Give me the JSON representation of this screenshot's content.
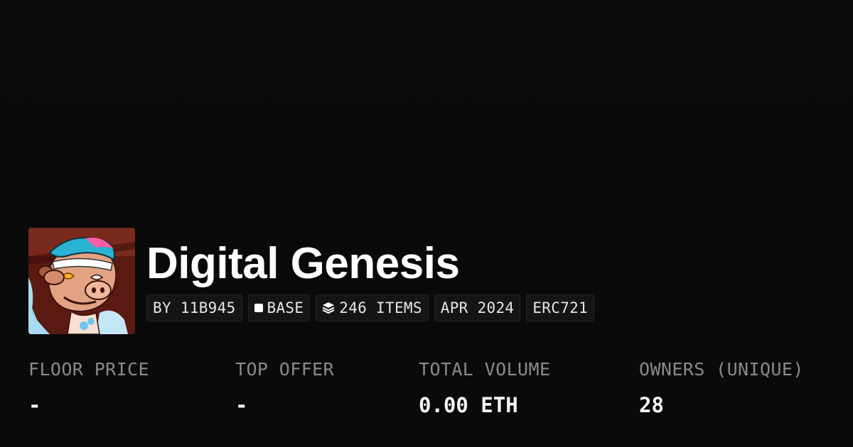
{
  "collection": {
    "name": "Digital Genesis"
  },
  "chips": [
    {
      "label": "BY 11B945",
      "icon": ""
    },
    {
      "label": "BASE",
      "icon": "base-chain-icon"
    },
    {
      "label": "246 ITEMS",
      "icon": "layers-icon"
    },
    {
      "label": "APR 2024",
      "icon": ""
    },
    {
      "label": "ERC721",
      "icon": ""
    }
  ],
  "stats": [
    {
      "label": "FLOOR PRICE",
      "value": "-"
    },
    {
      "label": "TOP OFFER",
      "value": "-"
    },
    {
      "label": "TOTAL VOLUME",
      "value": "0.00 ETH"
    },
    {
      "label": "OWNERS (UNIQUE)",
      "value": "28"
    }
  ],
  "colors": {
    "background": "#0a0a0a",
    "chip_background": "#151515",
    "label_gray": "#8a8a8a",
    "text_white": "#ffffff"
  }
}
